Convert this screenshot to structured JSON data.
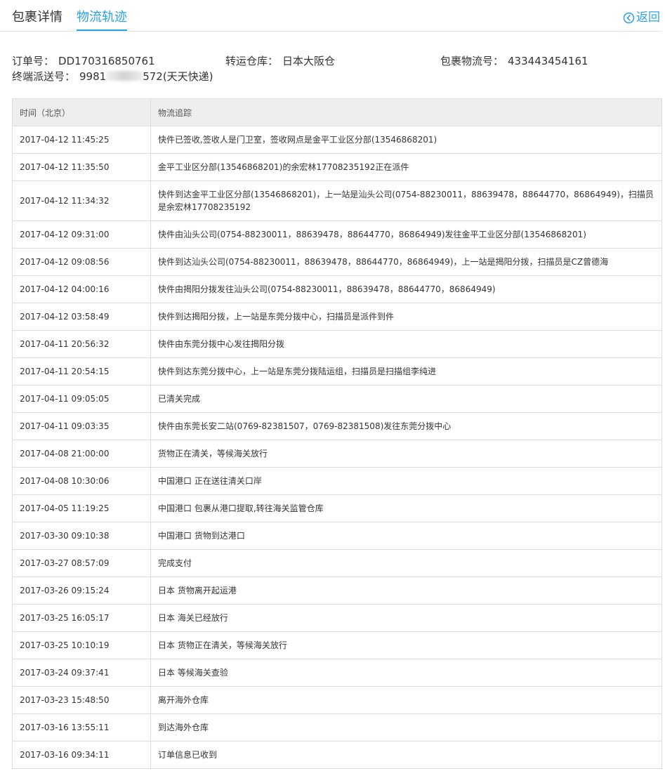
{
  "tabs": {
    "details": "包裹详情",
    "tracking": "物流轨迹",
    "back": "返回"
  },
  "info": {
    "order_label": "订单号：",
    "order_value": "DD170316850761",
    "warehouse_label": "转运仓库：",
    "warehouse_value": "日本大阪仓",
    "logistics_label": "包裹物流号：",
    "logistics_value": "433443454161",
    "delivery_label": "终端派送号：",
    "delivery_prefix": "9981",
    "delivery_suffix": "572(天天快递)"
  },
  "table": {
    "headers": [
      "时间（北京）",
      "物流追踪"
    ],
    "rows": [
      {
        "time": "2017-04-12 11:45:25",
        "event": "快件已签收,签收人是门卫室，签收网点是金平工业区分部(13546868201)"
      },
      {
        "time": "2017-04-12 11:35:50",
        "event": "金平工业区分部(13546868201)的余宏林17708235192正在派件"
      },
      {
        "time": "2017-04-12 11:34:32",
        "event": "快件到达金平工业区分部(13546868201)，上一站是汕头公司(0754-88230011，88639478，88644770，86864949)，扫描员是余宏林17708235192"
      },
      {
        "time": "2017-04-12 09:31:00",
        "event": "快件由汕头公司(0754-88230011，88639478，88644770，86864949)发往金平工业区分部(13546868201)"
      },
      {
        "time": "2017-04-12 09:08:56",
        "event": "快件到达汕头公司(0754-88230011，88639478，88644770，86864949)，上一站是揭阳分拨，扫描员是CZ曾德海"
      },
      {
        "time": "2017-04-12 04:00:16",
        "event": "快件由揭阳分拨发往汕头公司(0754-88230011，88639478，88644770，86864949)"
      },
      {
        "time": "2017-04-12 03:58:49",
        "event": "快件到达揭阳分拨，上一站是东莞分拨中心，扫描员是派件到件"
      },
      {
        "time": "2017-04-11 20:56:32",
        "event": "快件由东莞分拨中心发往揭阳分拨"
      },
      {
        "time": "2017-04-11 20:54:15",
        "event": "快件到达东莞分拨中心，上一站是东莞分拨陆运组，扫描员是扫描组李纯进"
      },
      {
        "time": "2017-04-11 09:05:05",
        "event": "已清关完成"
      },
      {
        "time": "2017-04-11 09:03:35",
        "event": "快件由东莞长安二站(0769-82381507，0769-82381508)发往东莞分拨中心"
      },
      {
        "time": "2017-04-08 21:00:00",
        "event": "货物正在清关，等候海关放行"
      },
      {
        "time": "2017-04-08 10:30:06",
        "event": "中国港口 正在送往清关口岸"
      },
      {
        "time": "2017-04-05 11:19:25",
        "event": "中国港口 包裹从港口提取,转往海关监管仓库"
      },
      {
        "time": "2017-03-30 09:10:38",
        "event": "中国港口 货物到达港口"
      },
      {
        "time": "2017-03-27 08:57:09",
        "event": "完成支付"
      },
      {
        "time": "2017-03-26 09:15:24",
        "event": "日本 货物离开起运港"
      },
      {
        "time": "2017-03-25 16:05:17",
        "event": "日本 海关已经放行"
      },
      {
        "time": "2017-03-25 10:10:19",
        "event": "日本 货物正在清关，等候海关放行"
      },
      {
        "time": "2017-03-24 09:37:41",
        "event": "日本 等候海关查验"
      },
      {
        "time": "2017-03-23 15:48:50",
        "event": "离开海外仓库"
      },
      {
        "time": "2017-03-16 13:55:11",
        "event": "到达海外仓库"
      },
      {
        "time": "2017-03-16 09:34:11",
        "event": "订单信息已收到"
      }
    ]
  },
  "colors": {
    "accent": "#2aa3e6",
    "header_bg": "#eeeeee",
    "border": "#dddddd",
    "text": "#333333"
  },
  "icons": {
    "back": "chevron-left-circle-icon"
  }
}
